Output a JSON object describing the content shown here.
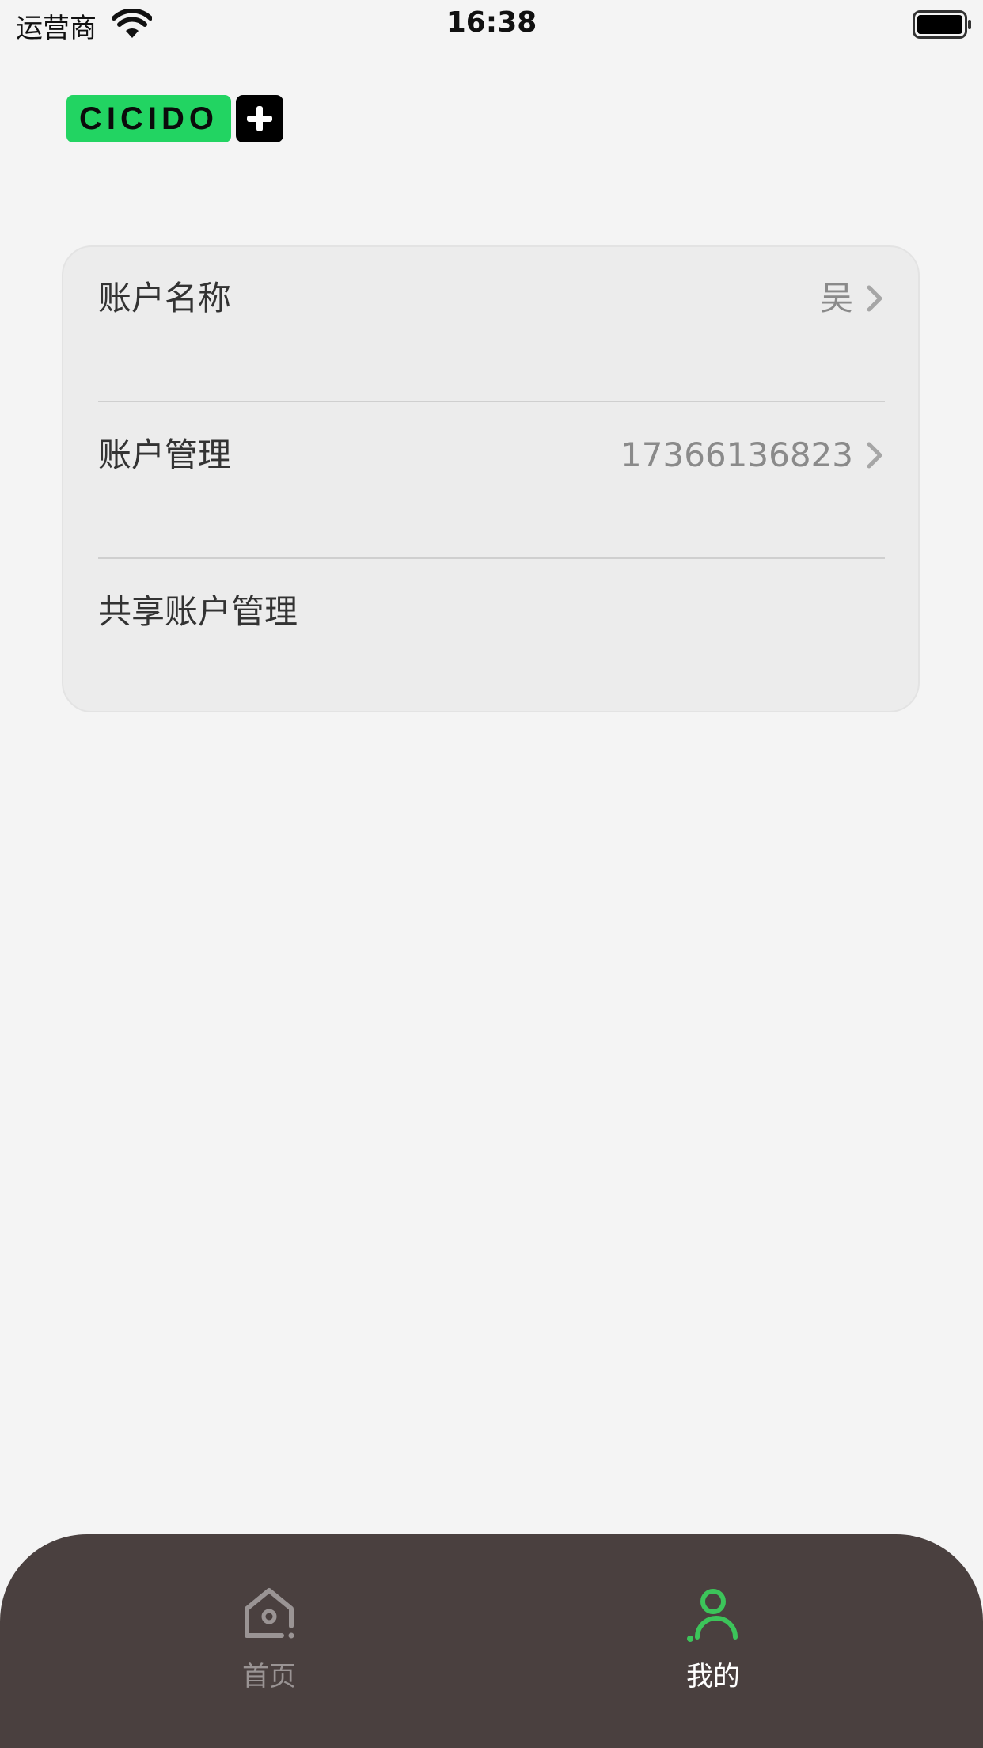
{
  "status_bar": {
    "carrier": "运营商",
    "time": "16:38"
  },
  "logo": {
    "text": "CICIDO",
    "color": "#22d462"
  },
  "account_list": [
    {
      "label": "账户名称",
      "value": "吴",
      "has_chevron": true
    },
    {
      "label": "账户管理",
      "value": "17366136823",
      "has_chevron": true
    },
    {
      "label": "共享账户管理",
      "value": "",
      "has_chevron": false
    }
  ],
  "tab_bar": {
    "tabs": [
      {
        "label": "首页",
        "icon": "home-icon",
        "active": false
      },
      {
        "label": "我的",
        "icon": "user-icon",
        "active": true
      }
    ],
    "background": "#4a403f",
    "active_color": "#3cc45a"
  }
}
